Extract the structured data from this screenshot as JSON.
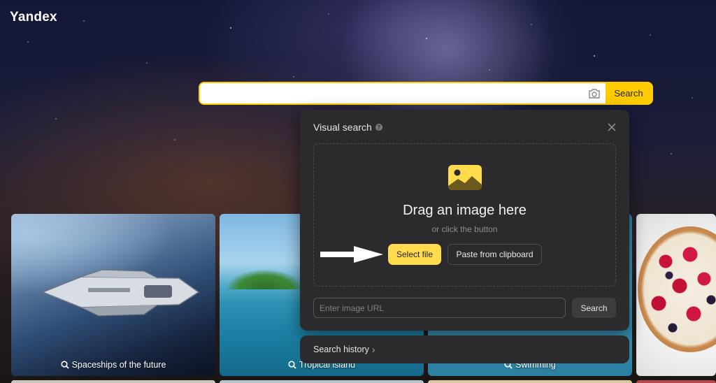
{
  "header": {
    "logo": "Yandex"
  },
  "search": {
    "value": "",
    "button_label": "Search",
    "camera_icon": "camera-icon"
  },
  "cards": [
    {
      "label": "Spaceships of the future"
    },
    {
      "label": "Tropical island"
    },
    {
      "label": "Swimming"
    },
    {
      "label": ""
    }
  ],
  "visual_search": {
    "title": "Visual search",
    "info_icon": "?",
    "drag_title": "Drag an image here",
    "drag_sub": "or click the button",
    "select_file_label": "Select file",
    "paste_label": "Paste from clipboard",
    "url_placeholder": "Enter image URL",
    "url_search_label": "Search",
    "history_label": "Search history",
    "history_chevron": "›"
  },
  "colors": {
    "accent": "#ffcc00",
    "dialog_bg": "#2b2b2d",
    "select_button": "#ffdb4d"
  }
}
